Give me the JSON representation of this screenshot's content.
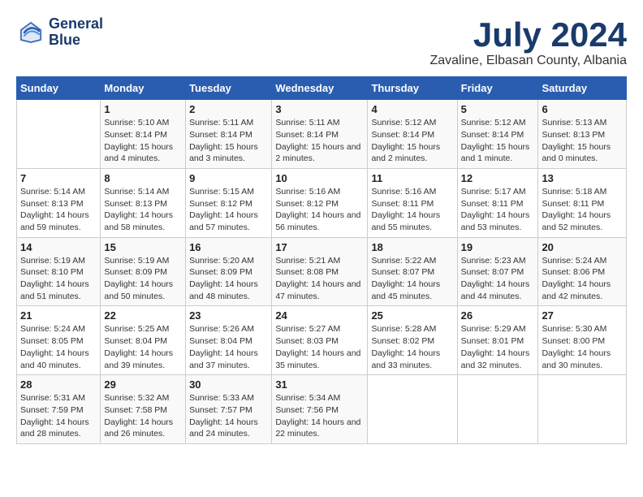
{
  "header": {
    "logo_line1": "General",
    "logo_line2": "Blue",
    "month": "July 2024",
    "location": "Zavaline, Elbasan County, Albania"
  },
  "weekdays": [
    "Sunday",
    "Monday",
    "Tuesday",
    "Wednesday",
    "Thursday",
    "Friday",
    "Saturday"
  ],
  "weeks": [
    [
      {
        "day": "",
        "sunrise": "",
        "sunset": "",
        "daylight": ""
      },
      {
        "day": "1",
        "sunrise": "Sunrise: 5:10 AM",
        "sunset": "Sunset: 8:14 PM",
        "daylight": "Daylight: 15 hours and 4 minutes."
      },
      {
        "day": "2",
        "sunrise": "Sunrise: 5:11 AM",
        "sunset": "Sunset: 8:14 PM",
        "daylight": "Daylight: 15 hours and 3 minutes."
      },
      {
        "day": "3",
        "sunrise": "Sunrise: 5:11 AM",
        "sunset": "Sunset: 8:14 PM",
        "daylight": "Daylight: 15 hours and 2 minutes."
      },
      {
        "day": "4",
        "sunrise": "Sunrise: 5:12 AM",
        "sunset": "Sunset: 8:14 PM",
        "daylight": "Daylight: 15 hours and 2 minutes."
      },
      {
        "day": "5",
        "sunrise": "Sunrise: 5:12 AM",
        "sunset": "Sunset: 8:14 PM",
        "daylight": "Daylight: 15 hours and 1 minute."
      },
      {
        "day": "6",
        "sunrise": "Sunrise: 5:13 AM",
        "sunset": "Sunset: 8:13 PM",
        "daylight": "Daylight: 15 hours and 0 minutes."
      }
    ],
    [
      {
        "day": "7",
        "sunrise": "Sunrise: 5:14 AM",
        "sunset": "Sunset: 8:13 PM",
        "daylight": "Daylight: 14 hours and 59 minutes."
      },
      {
        "day": "8",
        "sunrise": "Sunrise: 5:14 AM",
        "sunset": "Sunset: 8:13 PM",
        "daylight": "Daylight: 14 hours and 58 minutes."
      },
      {
        "day": "9",
        "sunrise": "Sunrise: 5:15 AM",
        "sunset": "Sunset: 8:12 PM",
        "daylight": "Daylight: 14 hours and 57 minutes."
      },
      {
        "day": "10",
        "sunrise": "Sunrise: 5:16 AM",
        "sunset": "Sunset: 8:12 PM",
        "daylight": "Daylight: 14 hours and 56 minutes."
      },
      {
        "day": "11",
        "sunrise": "Sunrise: 5:16 AM",
        "sunset": "Sunset: 8:11 PM",
        "daylight": "Daylight: 14 hours and 55 minutes."
      },
      {
        "day": "12",
        "sunrise": "Sunrise: 5:17 AM",
        "sunset": "Sunset: 8:11 PM",
        "daylight": "Daylight: 14 hours and 53 minutes."
      },
      {
        "day": "13",
        "sunrise": "Sunrise: 5:18 AM",
        "sunset": "Sunset: 8:11 PM",
        "daylight": "Daylight: 14 hours and 52 minutes."
      }
    ],
    [
      {
        "day": "14",
        "sunrise": "Sunrise: 5:19 AM",
        "sunset": "Sunset: 8:10 PM",
        "daylight": "Daylight: 14 hours and 51 minutes."
      },
      {
        "day": "15",
        "sunrise": "Sunrise: 5:19 AM",
        "sunset": "Sunset: 8:09 PM",
        "daylight": "Daylight: 14 hours and 50 minutes."
      },
      {
        "day": "16",
        "sunrise": "Sunrise: 5:20 AM",
        "sunset": "Sunset: 8:09 PM",
        "daylight": "Daylight: 14 hours and 48 minutes."
      },
      {
        "day": "17",
        "sunrise": "Sunrise: 5:21 AM",
        "sunset": "Sunset: 8:08 PM",
        "daylight": "Daylight: 14 hours and 47 minutes."
      },
      {
        "day": "18",
        "sunrise": "Sunrise: 5:22 AM",
        "sunset": "Sunset: 8:07 PM",
        "daylight": "Daylight: 14 hours and 45 minutes."
      },
      {
        "day": "19",
        "sunrise": "Sunrise: 5:23 AM",
        "sunset": "Sunset: 8:07 PM",
        "daylight": "Daylight: 14 hours and 44 minutes."
      },
      {
        "day": "20",
        "sunrise": "Sunrise: 5:24 AM",
        "sunset": "Sunset: 8:06 PM",
        "daylight": "Daylight: 14 hours and 42 minutes."
      }
    ],
    [
      {
        "day": "21",
        "sunrise": "Sunrise: 5:24 AM",
        "sunset": "Sunset: 8:05 PM",
        "daylight": "Daylight: 14 hours and 40 minutes."
      },
      {
        "day": "22",
        "sunrise": "Sunrise: 5:25 AM",
        "sunset": "Sunset: 8:04 PM",
        "daylight": "Daylight: 14 hours and 39 minutes."
      },
      {
        "day": "23",
        "sunrise": "Sunrise: 5:26 AM",
        "sunset": "Sunset: 8:04 PM",
        "daylight": "Daylight: 14 hours and 37 minutes."
      },
      {
        "day": "24",
        "sunrise": "Sunrise: 5:27 AM",
        "sunset": "Sunset: 8:03 PM",
        "daylight": "Daylight: 14 hours and 35 minutes."
      },
      {
        "day": "25",
        "sunrise": "Sunrise: 5:28 AM",
        "sunset": "Sunset: 8:02 PM",
        "daylight": "Daylight: 14 hours and 33 minutes."
      },
      {
        "day": "26",
        "sunrise": "Sunrise: 5:29 AM",
        "sunset": "Sunset: 8:01 PM",
        "daylight": "Daylight: 14 hours and 32 minutes."
      },
      {
        "day": "27",
        "sunrise": "Sunrise: 5:30 AM",
        "sunset": "Sunset: 8:00 PM",
        "daylight": "Daylight: 14 hours and 30 minutes."
      }
    ],
    [
      {
        "day": "28",
        "sunrise": "Sunrise: 5:31 AM",
        "sunset": "Sunset: 7:59 PM",
        "daylight": "Daylight: 14 hours and 28 minutes."
      },
      {
        "day": "29",
        "sunrise": "Sunrise: 5:32 AM",
        "sunset": "Sunset: 7:58 PM",
        "daylight": "Daylight: 14 hours and 26 minutes."
      },
      {
        "day": "30",
        "sunrise": "Sunrise: 5:33 AM",
        "sunset": "Sunset: 7:57 PM",
        "daylight": "Daylight: 14 hours and 24 minutes."
      },
      {
        "day": "31",
        "sunrise": "Sunrise: 5:34 AM",
        "sunset": "Sunset: 7:56 PM",
        "daylight": "Daylight: 14 hours and 22 minutes."
      },
      {
        "day": "",
        "sunrise": "",
        "sunset": "",
        "daylight": ""
      },
      {
        "day": "",
        "sunrise": "",
        "sunset": "",
        "daylight": ""
      },
      {
        "day": "",
        "sunrise": "",
        "sunset": "",
        "daylight": ""
      }
    ]
  ]
}
